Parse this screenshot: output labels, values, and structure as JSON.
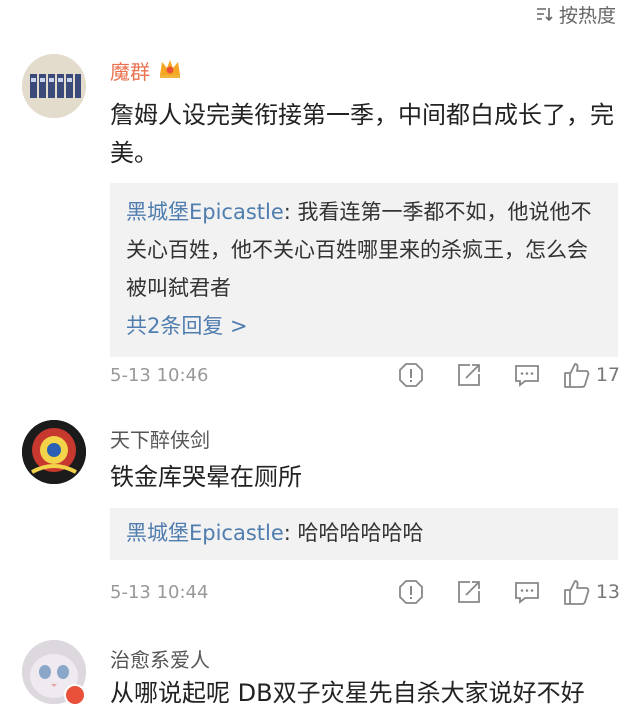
{
  "sort": {
    "label": "按热度",
    "icon": "sort-icon"
  },
  "comments": [
    {
      "username": "魔群",
      "text": "詹姆人设完美衔接第一季，中间都白成长了，完美。",
      "reply": {
        "name": "黑城堡Epicastle",
        "text": "我看连第一季都不如，他说他不关心百姓，他不关心百姓哪里来的杀疯王，怎么会被叫弑君者",
        "more": "共2条回复 >"
      },
      "time": "5-13 10:46",
      "likes": "17"
    },
    {
      "username": "天下醉侠剑",
      "text": "铁金库哭晕在厕所",
      "reply": {
        "name": "黑城堡Epicastle",
        "text": "哈哈哈哈哈哈"
      },
      "time": "5-13 10:44",
      "likes": "13"
    },
    {
      "username": "治愈系爱人",
      "text": "从哪说起呢 DB双子灾星先自杀大家说好不好"
    }
  ],
  "colors": {
    "username_vip": "#eb7350",
    "link": "#507daf",
    "reply_bg": "#f2f2f2"
  }
}
